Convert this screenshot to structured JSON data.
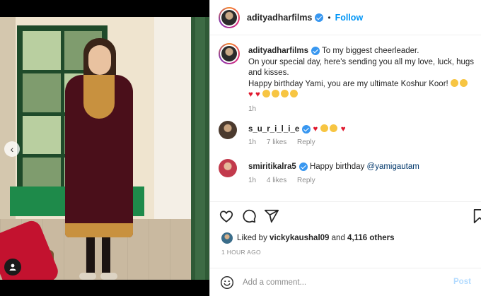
{
  "post": {
    "username": "adityadharfilms",
    "follow_label": "Follow",
    "separator": "•"
  },
  "caption": {
    "username": "adityadharfilms",
    "text_line1": "To my biggest cheerleader.",
    "text_line2": "On your special day, here's sending you all my love, luck, hugs and kisses.",
    "text_line3": "Happy birthday Yami, you are my ultimate Koshur Koor!",
    "time": "1h"
  },
  "comments": [
    {
      "username": "s_u_r_i_l_i_e",
      "text": "",
      "time": "1h",
      "likes": "7 likes",
      "reply": "Reply"
    },
    {
      "username": "smiritikalra5",
      "text": "Happy birthday ",
      "mention": "@yamigautam",
      "time": "1h",
      "likes": "4 likes",
      "reply": "Reply"
    }
  ],
  "likes": {
    "prefix": "Liked by ",
    "user": "vickykaushal09",
    "middle": " and ",
    "others": "4,116 others"
  },
  "timestamp": "1 HOUR AGO",
  "add_comment": {
    "placeholder": "Add a comment...",
    "post_label": "Post"
  },
  "icons": {
    "like": "heart-icon",
    "comment": "comment-icon",
    "share": "share-icon",
    "save": "bookmark-icon",
    "emoji": "smiley-icon",
    "carousel": "chevron-left-icon",
    "tag": "user-tag-icon"
  },
  "colors": {
    "follow": "#0095f6",
    "verified": "#3897f0",
    "heart": "#e0182d",
    "post_disabled": "#b3dbff"
  }
}
